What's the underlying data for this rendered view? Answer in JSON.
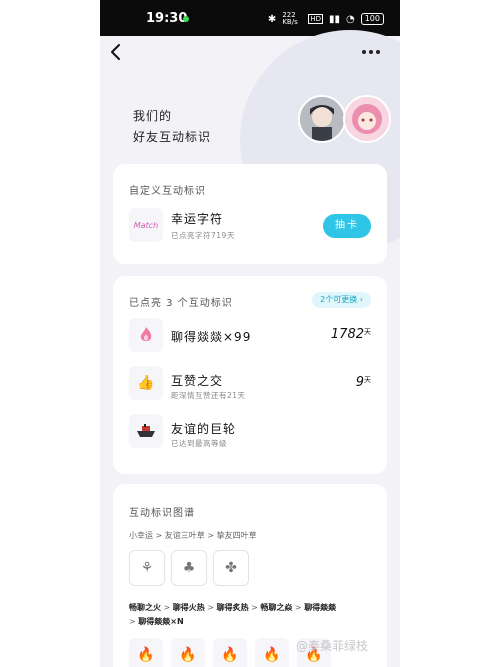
{
  "status_bar": {
    "time": "19:30",
    "network": "222 KB/s",
    "battery": "100"
  },
  "header": {
    "title_line1": "我们的",
    "title_line2": "好友互动标识"
  },
  "custom_card": {
    "title": "自定义互动标识",
    "item_name": "幸运字符",
    "item_sub": "已点亮字符719天",
    "button_label": "抽卡",
    "icon_text": "Match"
  },
  "lit_card": {
    "title": "已点亮 3 个互动标识",
    "swap_label": "2个可更换",
    "items": [
      {
        "name": "聊得燚燚×99",
        "sub": "",
        "count": "1782",
        "unit": "天",
        "icon": "flame-icon"
      },
      {
        "name": "互赞之交",
        "sub": "距深情互赞还有21天",
        "count": "9",
        "unit": "天",
        "icon": "thumbs-up-icon"
      },
      {
        "name": "友谊的巨轮",
        "sub": "已达到最高等级",
        "count": "",
        "unit": "",
        "icon": "ship-icon"
      }
    ]
  },
  "atlas_card": {
    "title": "互动标识图谱",
    "path1": [
      "小幸运",
      "友谊三叶草",
      "挚友四叶草"
    ],
    "path2_line1": [
      "畅聊之火",
      "聊得火热",
      "聊得炙热",
      "畅聊之焱",
      "聊得燚燚"
    ],
    "path2_line2": "聊得燚燚×N"
  },
  "watermark": "@泰桑菲绿枝"
}
